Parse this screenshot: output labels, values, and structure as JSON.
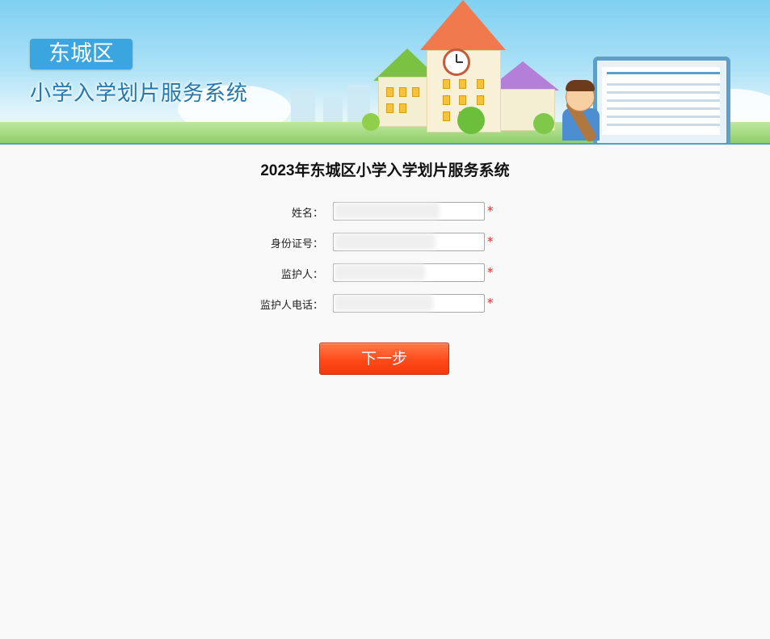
{
  "header": {
    "district": "东城区",
    "system_name": "小学入学划片服务系统"
  },
  "form": {
    "title": "2023年东城区小学入学划片服务系统",
    "fields": [
      {
        "label": "姓名：",
        "value": "",
        "required_mark": "*"
      },
      {
        "label": "身份证号：",
        "value": "",
        "required_mark": "*"
      },
      {
        "label": "监护人：",
        "value": "",
        "required_mark": "*"
      },
      {
        "label": "监护人电话：",
        "value": "",
        "required_mark": "*"
      }
    ],
    "next_button": "下一步"
  },
  "colors": {
    "accent": "#3aa5de",
    "button": "#ff4a1a",
    "required": "#e32a2a"
  }
}
